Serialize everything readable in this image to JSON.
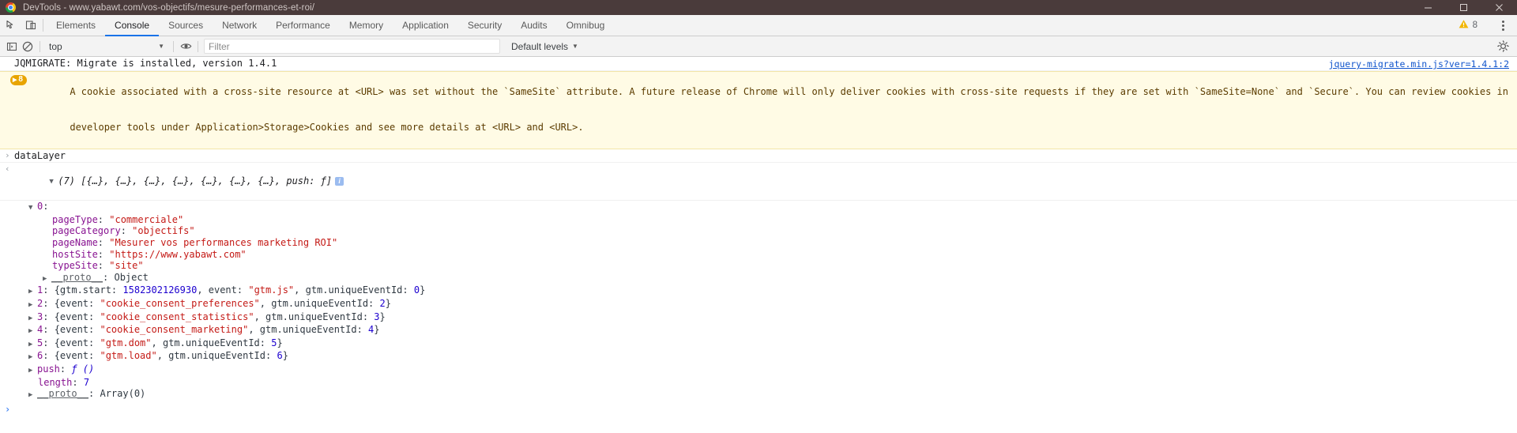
{
  "titlebar": {
    "title": "DevTools - www.yabawt.com/vos-objectifs/mesure-performances-et-roi/",
    "minimize": "—",
    "maximize": "□",
    "close": "✕"
  },
  "tabbar": {
    "inspect_icon": "inspect-cursor-icon",
    "device_icon": "device-toolbar-icon",
    "tabs": [
      {
        "label": "Elements",
        "active": false
      },
      {
        "label": "Console",
        "active": true
      },
      {
        "label": "Sources",
        "active": false
      },
      {
        "label": "Network",
        "active": false
      },
      {
        "label": "Performance",
        "active": false
      },
      {
        "label": "Memory",
        "active": false
      },
      {
        "label": "Application",
        "active": false
      },
      {
        "label": "Security",
        "active": false
      },
      {
        "label": "Audits",
        "active": false
      },
      {
        "label": "Omnibug",
        "active": false
      }
    ],
    "warning_icon": "warning-triangle-icon",
    "warning_count": "8",
    "menu_icon": "kebab-menu-icon",
    "warning_color": "#f2b600"
  },
  "console_toolbar": {
    "sidebar_icon": "console-sidebar-icon",
    "clear_icon": "clear-console-icon",
    "context": "top",
    "context_caret": "▼",
    "eye_icon": "live-expression-eye-icon",
    "filter_placeholder": "Filter",
    "filter_value": "",
    "levels_label": "Default levels",
    "levels_caret": "▼",
    "settings_icon": "gear-icon"
  },
  "console": {
    "jqmigrate": {
      "text": "JQMIGRATE: Migrate is installed, version 1.4.1",
      "source": "jquery-migrate.min.js?ver=1.4.1:2"
    },
    "warning": {
      "badge_arrow": "▶",
      "badge_count": "8",
      "line1": "A cookie associated with a cross-site resource at <URL> was set without the `SameSite` attribute. A future release of Chrome will only deliver cookies with cross-site requests if they are set with `SameSite=None` and `Secure`. You can review cookies in",
      "line2": "developer tools under Application>Storage>Cookies and see more details at <URL> and <URL>."
    },
    "command": {
      "prompt": "›",
      "text": "dataLayer"
    },
    "result": {
      "return_marker": "‹",
      "disclosure": "▼",
      "summary": "(7) [{…}, {…}, {…}, {…}, {…}, {…}, {…}, push: ƒ]",
      "info_badge": "i"
    },
    "tree": {
      "index0": {
        "arrow": "▼",
        "label": "0",
        "colon": ":"
      },
      "props": [
        {
          "key": "pageType",
          "value": "\"commerciale\""
        },
        {
          "key": "pageCategory",
          "value": "\"objectifs\""
        },
        {
          "key": "pageName",
          "value": "\"Mesurer vos performances marketing ROI\""
        },
        {
          "key": "hostSite",
          "value": "\"https://www.yabawt.com\""
        },
        {
          "key": "typeSite",
          "value": "\"site\""
        }
      ],
      "proto_inner": {
        "arrow": "▶",
        "key": "__proto__",
        "value": "Object"
      },
      "items": [
        {
          "arrow": "▶",
          "index": "1",
          "parts": [
            {
              "t": "{gtm.start: ",
              "c": "plain"
            },
            {
              "t": "1582302126930",
              "c": "num"
            },
            {
              "t": ", event: ",
              "c": "plain"
            },
            {
              "t": "\"gtm.js\"",
              "c": "str"
            },
            {
              "t": ", gtm.uniqueEventId: ",
              "c": "plain"
            },
            {
              "t": "0",
              "c": "num"
            },
            {
              "t": "}",
              "c": "plain"
            }
          ]
        },
        {
          "arrow": "▶",
          "index": "2",
          "parts": [
            {
              "t": "{event: ",
              "c": "plain"
            },
            {
              "t": "\"cookie_consent_preferences\"",
              "c": "str"
            },
            {
              "t": ", gtm.uniqueEventId: ",
              "c": "plain"
            },
            {
              "t": "2",
              "c": "num"
            },
            {
              "t": "}",
              "c": "plain"
            }
          ]
        },
        {
          "arrow": "▶",
          "index": "3",
          "parts": [
            {
              "t": "{event: ",
              "c": "plain"
            },
            {
              "t": "\"cookie_consent_statistics\"",
              "c": "str"
            },
            {
              "t": ", gtm.uniqueEventId: ",
              "c": "plain"
            },
            {
              "t": "3",
              "c": "num"
            },
            {
              "t": "}",
              "c": "plain"
            }
          ]
        },
        {
          "arrow": "▶",
          "index": "4",
          "parts": [
            {
              "t": "{event: ",
              "c": "plain"
            },
            {
              "t": "\"cookie_consent_marketing\"",
              "c": "str"
            },
            {
              "t": ", gtm.uniqueEventId: ",
              "c": "plain"
            },
            {
              "t": "4",
              "c": "num"
            },
            {
              "t": "}",
              "c": "plain"
            }
          ]
        },
        {
          "arrow": "▶",
          "index": "5",
          "parts": [
            {
              "t": "{event: ",
              "c": "plain"
            },
            {
              "t": "\"gtm.dom\"",
              "c": "str"
            },
            {
              "t": ", gtm.uniqueEventId: ",
              "c": "plain"
            },
            {
              "t": "5",
              "c": "num"
            },
            {
              "t": "}",
              "c": "plain"
            }
          ]
        },
        {
          "arrow": "▶",
          "index": "6",
          "parts": [
            {
              "t": "{event: ",
              "c": "plain"
            },
            {
              "t": "\"gtm.load\"",
              "c": "str"
            },
            {
              "t": ", gtm.uniqueEventId: ",
              "c": "plain"
            },
            {
              "t": "6",
              "c": "num"
            },
            {
              "t": "}",
              "c": "plain"
            }
          ]
        }
      ],
      "push": {
        "arrow": "▶",
        "key": "push",
        "value": "ƒ ()"
      },
      "length": {
        "key": "length",
        "value": "7"
      },
      "proto_outer": {
        "arrow": "▶",
        "key": "__proto__",
        "value": "Array(0)"
      }
    },
    "input_prompt": "›",
    "input_value": ""
  },
  "colors": {
    "accent": "#1a73e8",
    "warning_bg": "#fffbe5",
    "warning_text": "#5c3c00",
    "string": "#c41a16",
    "number": "#1c00cf",
    "property": "#881391",
    "link": "#1155cc"
  }
}
